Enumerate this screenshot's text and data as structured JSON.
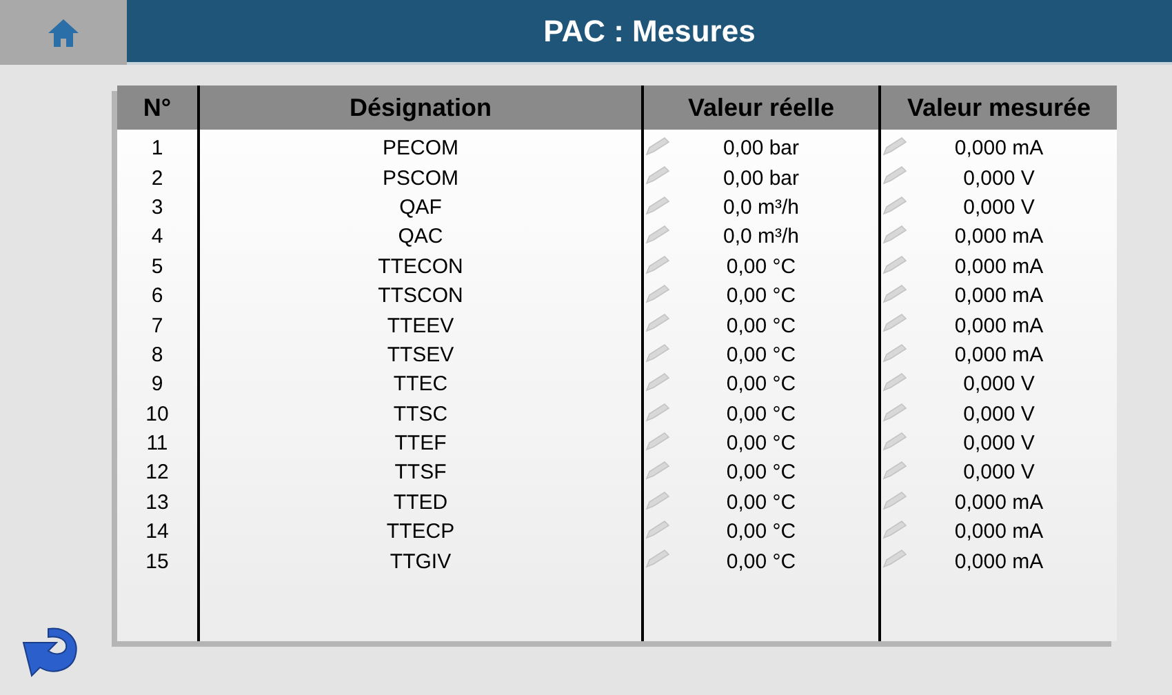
{
  "header": {
    "title": "PAC : Mesures"
  },
  "table": {
    "columns": [
      "N°",
      "Désignation",
      "Valeur réelle",
      "Valeur mesurée"
    ],
    "rows": [
      {
        "n": "1",
        "name": "PECOM",
        "real": "0,00 bar",
        "measured": "0,000 mA"
      },
      {
        "n": "2",
        "name": "PSCOM",
        "real": "0,00 bar",
        "measured": "0,000 V"
      },
      {
        "n": "3",
        "name": "QAF",
        "real": "0,0 m³/h",
        "measured": "0,000 V"
      },
      {
        "n": "4",
        "name": "QAC",
        "real": "0,0 m³/h",
        "measured": "0,000 mA"
      },
      {
        "n": "5",
        "name": "TTECON",
        "real": "0,00 °C",
        "measured": "0,000 mA"
      },
      {
        "n": "6",
        "name": "TTSCON",
        "real": "0,00 °C",
        "measured": "0,000 mA"
      },
      {
        "n": "7",
        "name": "TTEEV",
        "real": "0,00 °C",
        "measured": "0,000 mA"
      },
      {
        "n": "8",
        "name": "TTSEV",
        "real": "0,00 °C",
        "measured": "0,000 mA"
      },
      {
        "n": "9",
        "name": "TTEC",
        "real": "0,00 °C",
        "measured": "0,000 V"
      },
      {
        "n": "10",
        "name": "TTSC",
        "real": "0,00 °C",
        "measured": "0,000 V"
      },
      {
        "n": "11",
        "name": "TTEF",
        "real": "0,00 °C",
        "measured": "0,000 V"
      },
      {
        "n": "12",
        "name": "TTSF",
        "real": "0,00 °C",
        "measured": "0,000 V"
      },
      {
        "n": "13",
        "name": "TTED",
        "real": "0,00 °C",
        "measured": "0,000 mA"
      },
      {
        "n": "14",
        "name": "TTECP",
        "real": "0,00 °C",
        "measured": "0,000 mA"
      },
      {
        "n": "15",
        "name": "TTGIV",
        "real": "0,00 °C",
        "measured": "0,000 mA"
      }
    ]
  }
}
